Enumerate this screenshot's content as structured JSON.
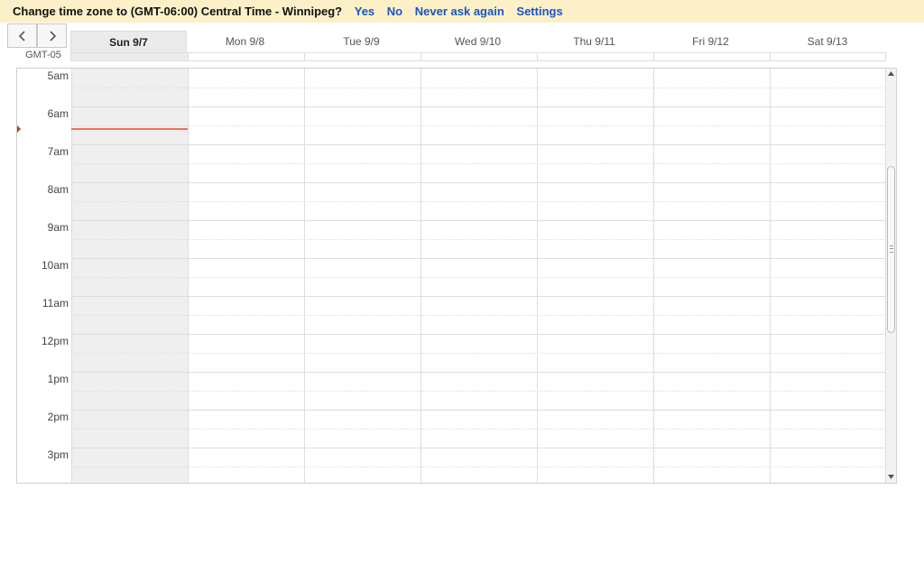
{
  "timezone_banner": {
    "message": "Change time zone to (GMT-06:00) Central Time - Winnipeg?",
    "links": [
      "Yes",
      "No",
      "Never ask again",
      "Settings"
    ]
  },
  "calendar": {
    "timezone_label": "GMT-05",
    "days": [
      {
        "label": "Sun 9/7",
        "today": true
      },
      {
        "label": "Mon 9/8",
        "today": false
      },
      {
        "label": "Tue 9/9",
        "today": false
      },
      {
        "label": "Wed 9/10",
        "today": false
      },
      {
        "label": "Thu 9/11",
        "today": false
      },
      {
        "label": "Fri 9/12",
        "today": false
      },
      {
        "label": "Sat 9/13",
        "today": false
      }
    ],
    "hours": [
      "5am",
      "6am",
      "7am",
      "8am",
      "9am",
      "10am",
      "11am",
      "12pm",
      "1pm",
      "2pm",
      "3pm"
    ],
    "current_time_hours_after_first": 1.6
  },
  "colors": {
    "banner_bg": "#fbf0c8",
    "link": "#1a55c4",
    "today_column": "#efefef",
    "now_line": "#f07060"
  }
}
